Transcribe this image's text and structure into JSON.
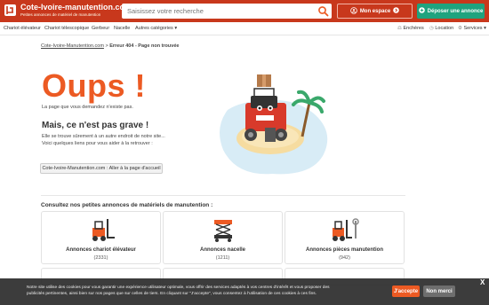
{
  "header": {
    "site_title": "Cote-Ivoire-manutention.com",
    "site_subtitle": "Petites annonces de matériel de manutention",
    "search_placeholder": "Saisissez votre recherche",
    "my_space_label": "Mon espace",
    "post_ad_label": "Déposer une annonce",
    "brand_color": "#c8381c",
    "cta_color": "#1fa37e"
  },
  "nav": {
    "items": [
      "Chariot élévateur",
      "Chariot télescopique",
      "Gerbeur",
      "Nacelle",
      "Autres catégories"
    ],
    "right_items": [
      "Enchères",
      "Location",
      "Services"
    ]
  },
  "breadcrumb": {
    "home": "Cote-Ivoire-Manutention.com",
    "separator": ">",
    "current": "Erreur 404 - Page non trouvée"
  },
  "error": {
    "heading": "Oups !",
    "lost_text": "La page que vous demandez n'existe pas.",
    "subheading": "Mais, ce n'est pas grave !",
    "paragraph_1": "Elle se trouve sûrement à un autre endroit de notre site...",
    "paragraph_2": "Voici quelques liens pour vous aider à la retrouver :",
    "home_button": "Cote-Ivoire-Manutention.com : Aller à la page d'accueil",
    "accent_color": "#ec5a23"
  },
  "listings": {
    "title": "Consultez nos petites annonces de matériels de manutention :",
    "cards": [
      {
        "label": "Annonces chariot élévateur",
        "count": "(2331)",
        "icon": "forklift-icon"
      },
      {
        "label": "Annonces nacelle",
        "count": "(1211)",
        "icon": "scissor-lift-icon"
      },
      {
        "label": "Annonces pièces manutention",
        "count": "(942)",
        "icon": "forklift-parts-icon"
      }
    ]
  },
  "cookie": {
    "text": "Notre site utilise des cookies pour vous garantir une expérience utilisateur optimale, vous offrir des services adaptés à vos centres d'intérêt et vous proposer des publicités pertinentes, ainsi bien sur nos pages que sur celles de tiers. En cliquant sur \"J'accepte\", vous consentez à l'utilisation de ces cookies à ces fins.",
    "accept_label": "J'accepte",
    "refuse_label": "Non merci",
    "close_label": "X"
  }
}
